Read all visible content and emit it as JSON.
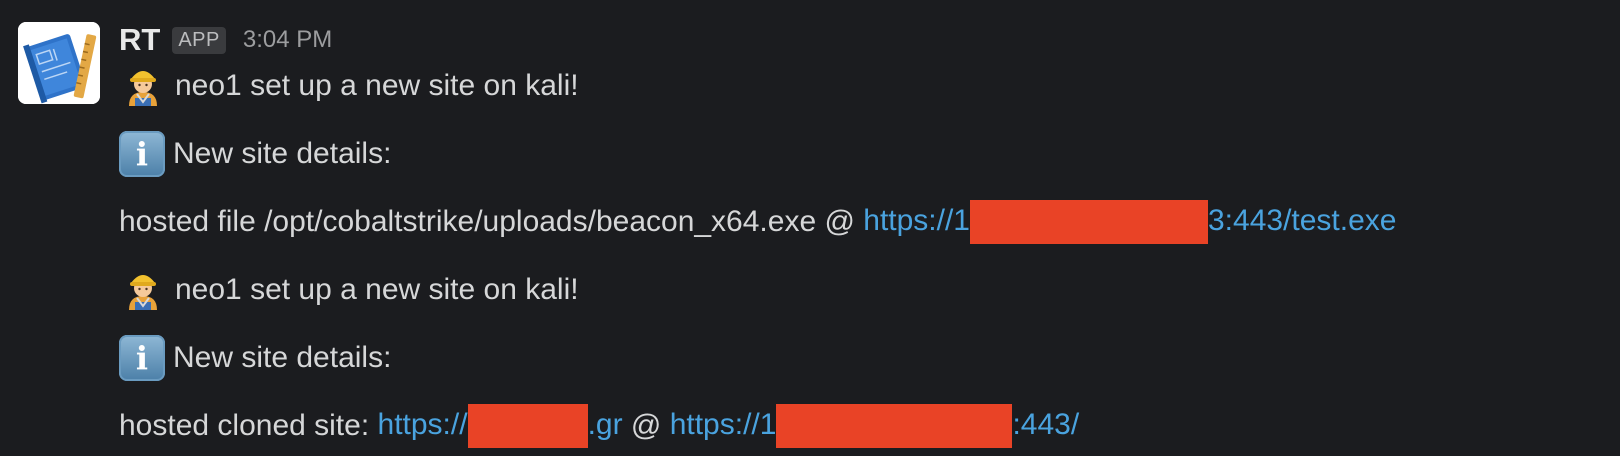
{
  "message": {
    "sender": "RT",
    "badge": "APP",
    "time": "3:04 PM"
  },
  "lines": [
    {
      "text": "neo1 set up a new site on kali!"
    },
    {
      "text": "New site details:"
    },
    {
      "prefix": "hosted file /opt/cobaltstrike/uploads/beacon_x64.exe @ ",
      "link_start": "https://1",
      "link_end": "3:443/test.exe"
    },
    {
      "text": "neo1 set up a new site on kali!"
    },
    {
      "text": "New site details:"
    },
    {
      "prefix": "hosted cloned site: ",
      "link1_start": "https://",
      "link1_end": ".gr",
      "separator": " @ ",
      "link2_start": "https://1",
      "link2_end": ":443/"
    }
  ],
  "icons": {
    "avatar": "blueprint-icon",
    "worker": "construction-worker-icon",
    "info": "information-icon"
  },
  "colors": {
    "background": "#1b1c1f",
    "link": "#4aa3df",
    "redaction": "#e94326"
  }
}
